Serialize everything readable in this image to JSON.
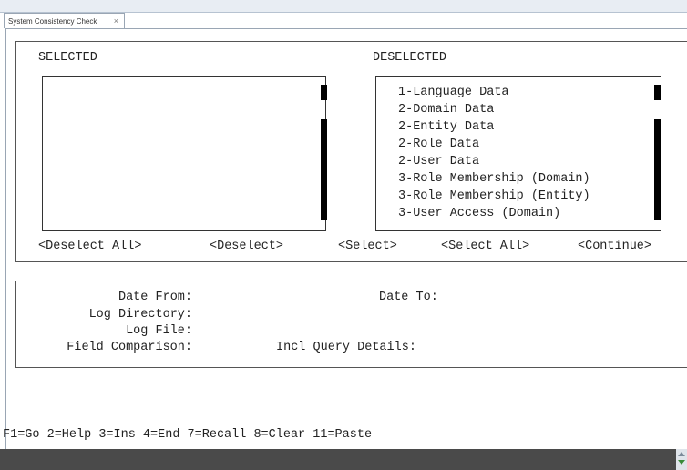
{
  "window": {
    "tab_title": "System Consistency Check",
    "tab_close": "×"
  },
  "selection": {
    "selected_label": "SELECTED",
    "deselected_label": "DESELECTED",
    "selected_items": [],
    "deselected_items": [
      "1-Language Data",
      "2-Domain Data",
      "2-Entity Data",
      "2-Role Data",
      "2-User Data",
      "3-Role Membership (Domain)",
      "3-Role Membership (Entity)",
      "3-User Access (Domain)"
    ],
    "buttons": {
      "deselect_all": "<Deselect All>",
      "deselect": "<Deselect>",
      "select": "<Select>",
      "select_all": "<Select All>",
      "continue": "<Continue>"
    }
  },
  "form": {
    "date_from": "Date From:",
    "date_to": "Date To:",
    "log_directory": "Log Directory:",
    "log_file": "Log File:",
    "field_comparison": "Field Comparison:",
    "incl_query_details": "Incl Query Details:"
  },
  "function_keys": "F1=Go 2=Help 3=Ins 4=End 7=Recall 8=Clear 11=Paste"
}
